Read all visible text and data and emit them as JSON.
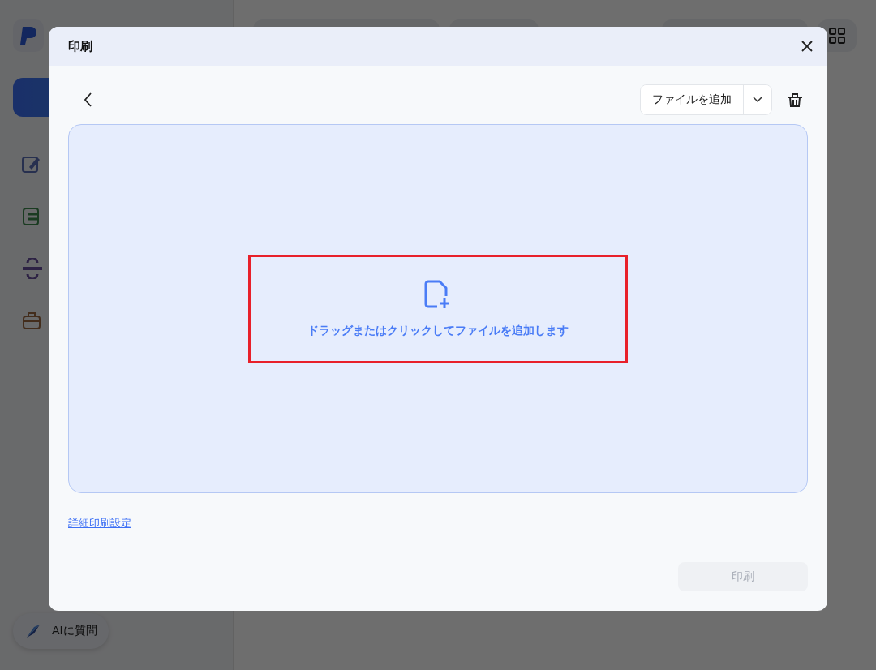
{
  "background": {
    "ai_button": "AIに質問"
  },
  "dialog": {
    "title": "印刷",
    "add_file_button": "ファイルを追加",
    "drop_zone": {
      "text": "ドラッグまたはクリックしてファイルを追加します",
      "highlighted": true
    },
    "advanced_link": "詳細印刷設定",
    "print_button": {
      "label": "印刷",
      "disabled": true
    }
  }
}
